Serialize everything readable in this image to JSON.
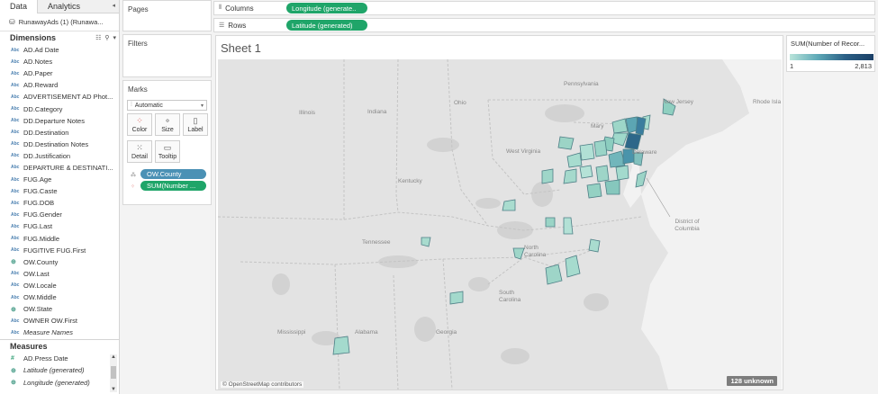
{
  "datapane": {
    "tabs": [
      "Data",
      "Analytics"
    ],
    "datasource": "RunawayAds (1) (Runawa...",
    "dimensions_header": "Dimensions",
    "dimensions": [
      {
        "type": "Abc",
        "name": "AD.Ad Date"
      },
      {
        "type": "Abc",
        "name": "AD.Notes"
      },
      {
        "type": "Abc",
        "name": "AD.Paper"
      },
      {
        "type": "Abc",
        "name": "AD.Reward"
      },
      {
        "type": "Abc",
        "name": "ADVERTISEMENT AD Phot..."
      },
      {
        "type": "Abc",
        "name": "DD.Category"
      },
      {
        "type": "Abc",
        "name": "DD.Departure Notes"
      },
      {
        "type": "Abc",
        "name": "DD.Destination"
      },
      {
        "type": "Abc",
        "name": "DD.Destination Notes"
      },
      {
        "type": "Abc",
        "name": "DD.Justification"
      },
      {
        "type": "Abc",
        "name": "DEPARTURE & DESTINATI..."
      },
      {
        "type": "Abc",
        "name": "FUG.Age"
      },
      {
        "type": "Abc",
        "name": "FUG.Caste"
      },
      {
        "type": "Abc",
        "name": "FUG.DOB"
      },
      {
        "type": "Abc",
        "name": "FUG.Gender"
      },
      {
        "type": "Abc",
        "name": "FUG.Last"
      },
      {
        "type": "Abc",
        "name": "FUG.Middle"
      },
      {
        "type": "Abc",
        "name": "FUGITIVE FUG.First"
      },
      {
        "type": "geo",
        "name": "OW.County"
      },
      {
        "type": "Abc",
        "name": "OW.Last"
      },
      {
        "type": "Abc",
        "name": "OW.Locale"
      },
      {
        "type": "Abc",
        "name": "OW.Middle"
      },
      {
        "type": "geo",
        "name": "OW.State"
      },
      {
        "type": "Abc",
        "name": "OWNER OW.First"
      },
      {
        "type": "Abc",
        "name": "Measure Names",
        "italic": true
      }
    ],
    "measures_header": "Measures",
    "measures": [
      {
        "type": "#",
        "name": "AD.Press Date"
      },
      {
        "type": "geo",
        "name": "Latitude (generated)",
        "italic": true
      },
      {
        "type": "geo",
        "name": "Longitude (generated)",
        "italic": true
      }
    ]
  },
  "pages": {
    "title": "Pages"
  },
  "filters": {
    "title": "Filters"
  },
  "marks": {
    "title": "Marks",
    "type": "Automatic",
    "buttons": {
      "color": "Color",
      "size": "Size",
      "label": "Label",
      "detail": "Detail",
      "tooltip": "Tooltip"
    },
    "pills": [
      "OW.County",
      "SUM(Number ..."
    ]
  },
  "shelves": {
    "columns_label": "Columns",
    "columns_pill": "Longitude (generate..",
    "rows_label": "Rows",
    "rows_pill": "Latitude (generated)"
  },
  "sheet": {
    "title": "Sheet 1",
    "attribution": "© OpenStreetMap contributors",
    "unknown": "128 unknown",
    "map_labels": {
      "pennsylvania": "Pennsylvania",
      "new_jersey": "New Jersey",
      "rhode_island": "Rhode Isla",
      "illinois": "Illinois",
      "indiana": "Indiana",
      "ohio": "Ohio",
      "maryland": "Mary",
      "west_virginia": "West Virginia",
      "delaware": "Delaware",
      "kentucky": "Kentucky",
      "district_of_columbia": "District of Columbia",
      "tennessee": "Tennessee",
      "north_carolina": "North Carolina",
      "south_carolina": "South Carolina",
      "mississippi": "Mississippi",
      "alabama": "Alabama",
      "georgia": "Georgia"
    }
  },
  "legend": {
    "title": "SUM(Number of Recor...",
    "min": "1",
    "max": "2,813",
    "colors": {
      "low": "#b9e4da",
      "high": "#1b3f66"
    }
  }
}
